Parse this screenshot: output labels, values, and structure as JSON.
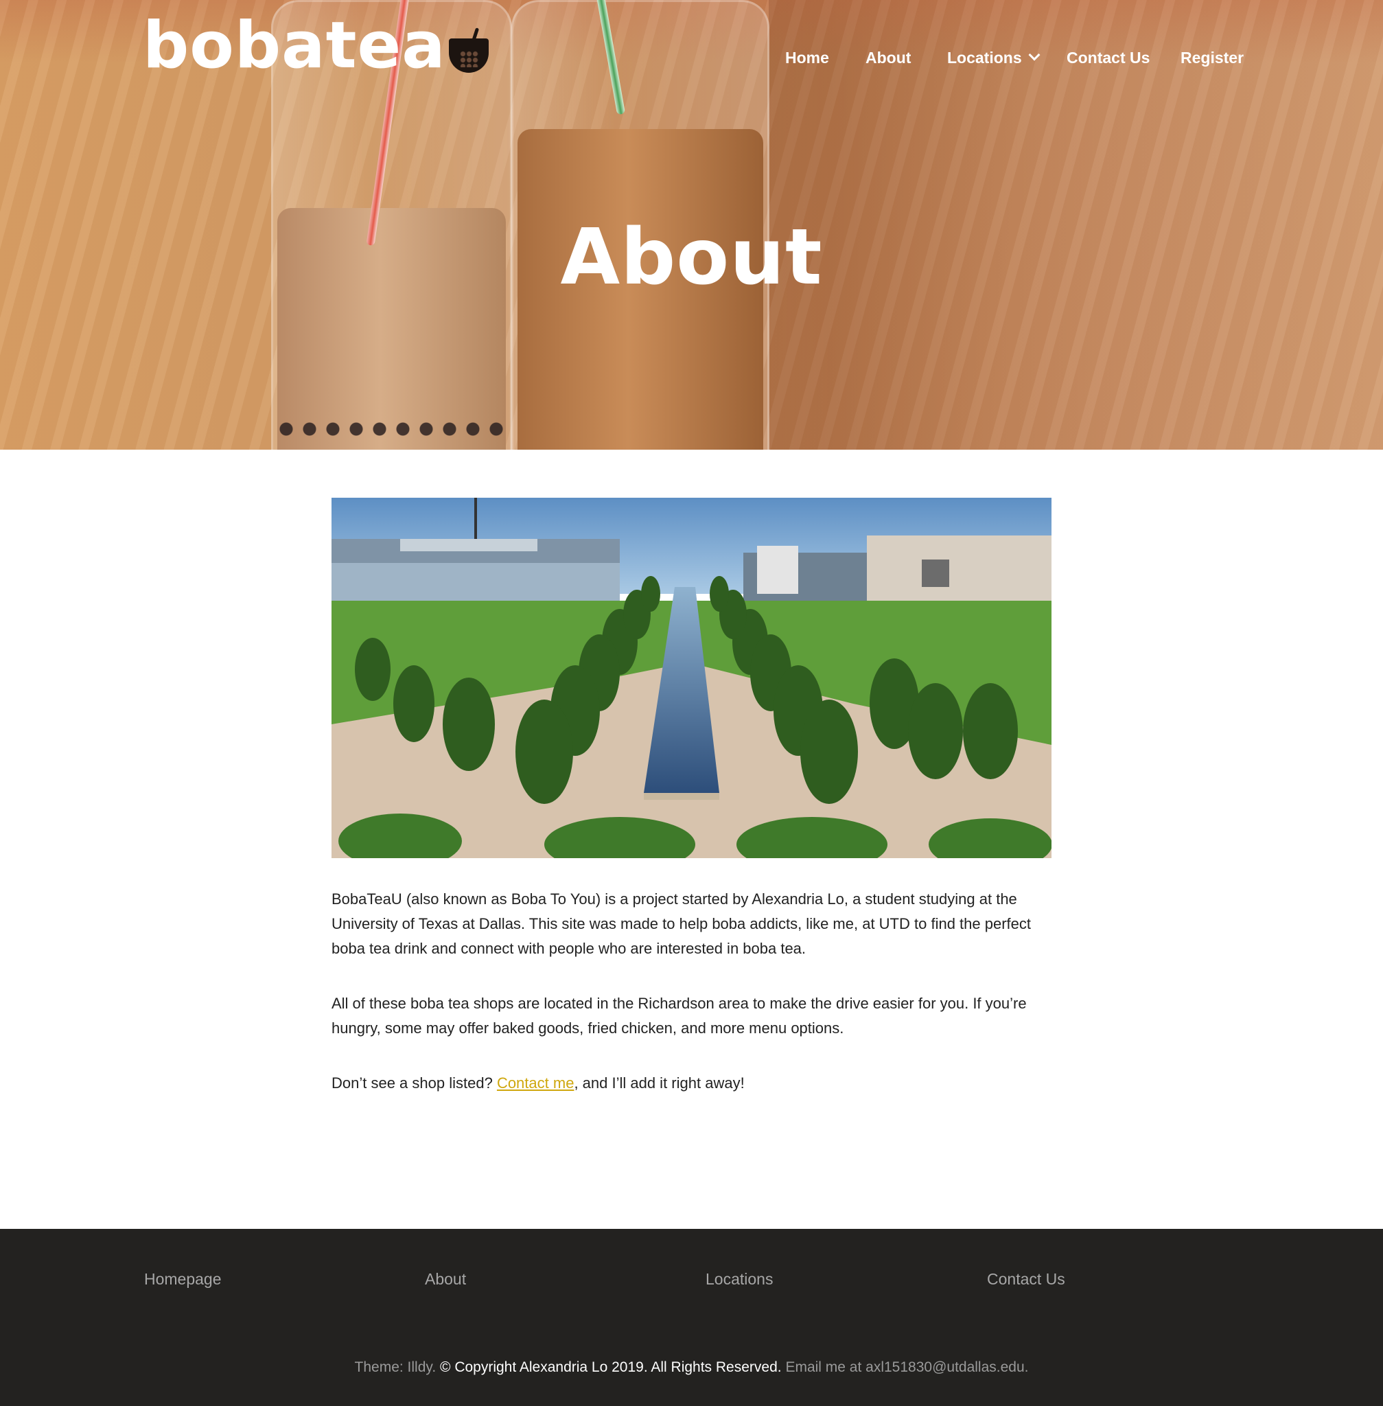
{
  "header": {
    "logo_text": "bobatea",
    "nav": {
      "home": "Home",
      "about": "About",
      "locations": "Locations",
      "contact": "Contact Us",
      "register": "Register"
    }
  },
  "hero": {
    "title": "About"
  },
  "content": {
    "image_alt": "University of Texas at Dallas campus mall with reflecting pools and rows of trees",
    "paragraph_1": "BobaTeaU (also known as Boba To You) is a project started by Alexandria Lo, a student studying at the University of Texas at Dallas. This site was made to help boba addicts, like me, at UTD to find the perfect boba tea drink and connect with people who are interested in boba tea.",
    "paragraph_2": "All of these boba tea shops are located in the Richardson area to make the drive easier for you. If you’re hungry, some may offer baked goods, fried chicken, and more menu options.",
    "paragraph_3": {
      "before": "Don’t see a shop listed? ",
      "link": "Contact me",
      "after": ", and I’ll add it right away!"
    }
  },
  "footer": {
    "links": {
      "homepage": "Homepage",
      "about": "About",
      "locations": "Locations",
      "contact": "Contact Us"
    },
    "theme": "Theme: Illdy.",
    "copyright": "© Copyright Alexandria Lo 2019. All Rights Reserved.",
    "email": "Email me at axl151830@utdallas.edu."
  },
  "colors": {
    "link_accent": "#cfa70d",
    "footer_bg": "#232220",
    "hero_tint": "#c8764e"
  },
  "icons": {
    "nav_dropdown": "chevron-down-icon",
    "logo_mark": "boba-cup-icon"
  }
}
